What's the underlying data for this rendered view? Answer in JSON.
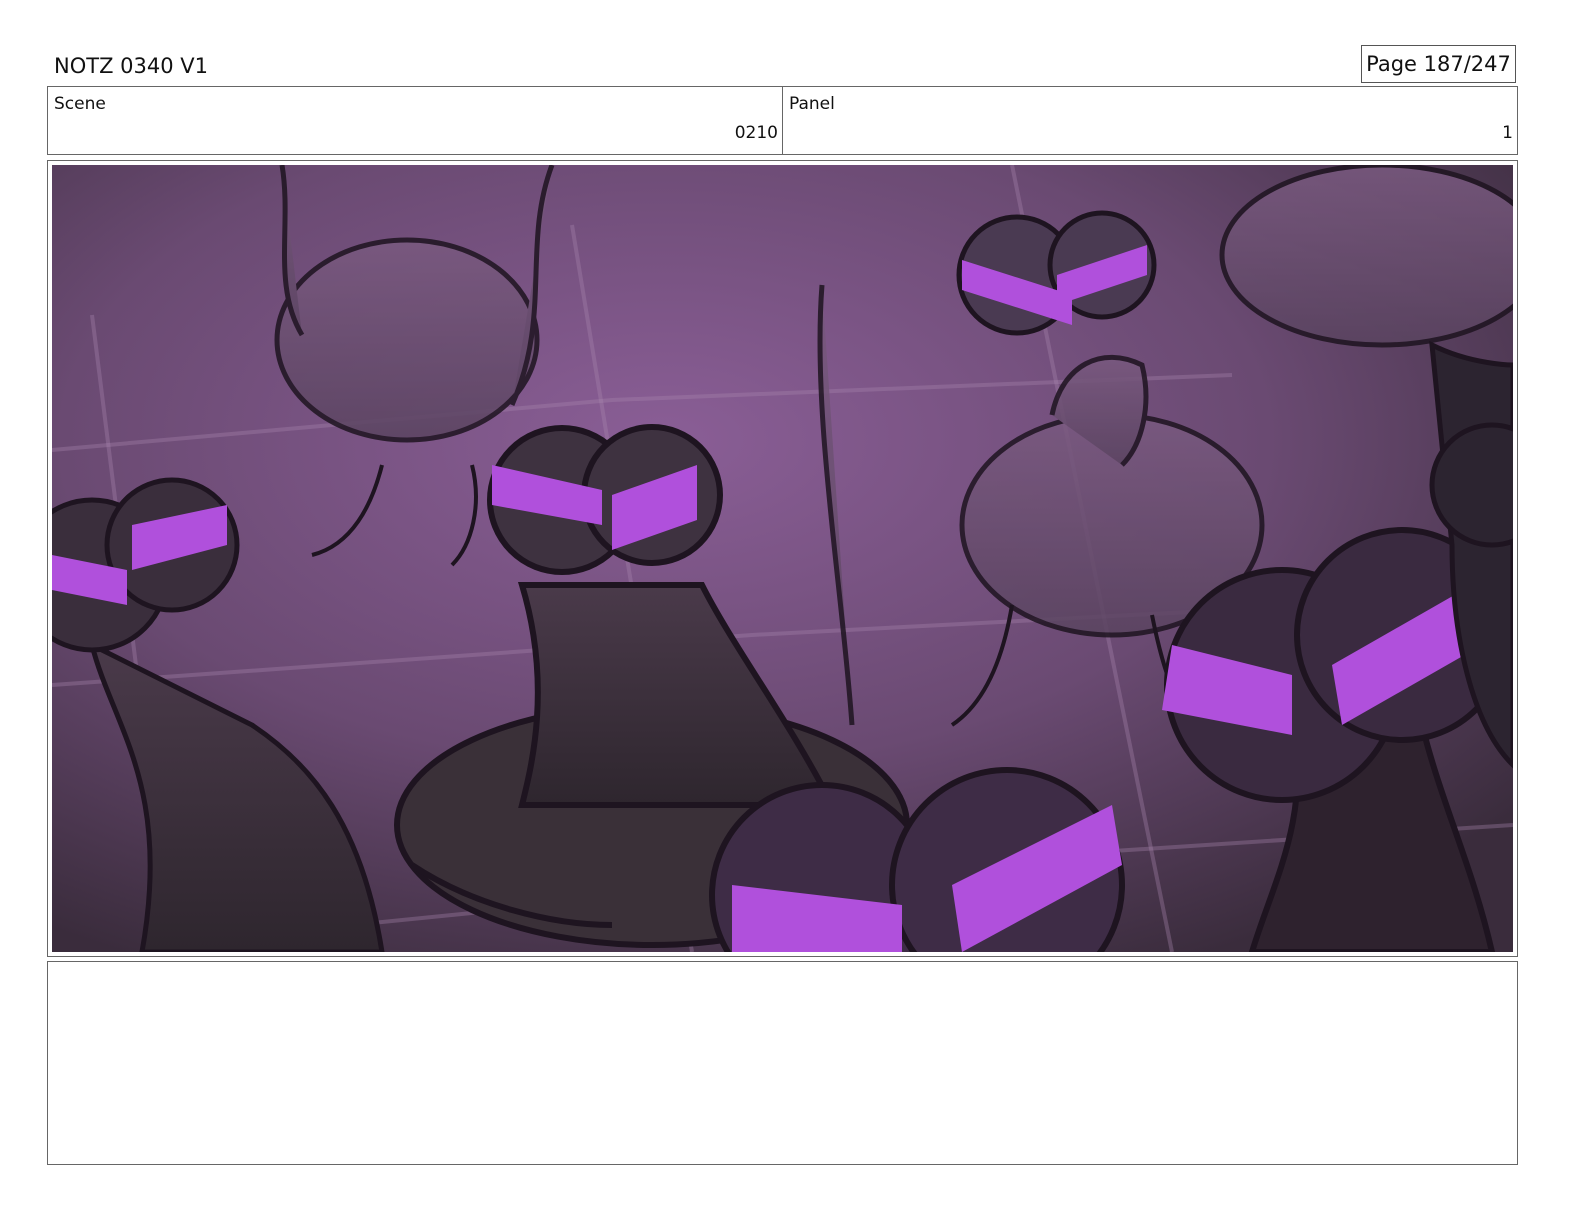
{
  "header": {
    "title": "NOTZ 0340 V1",
    "page": "Page 187/247"
  },
  "info": {
    "scene_label": "Scene",
    "scene_value": "0210",
    "panel_label": "Panel",
    "panel_value": "1"
  },
  "artwork": {
    "description_icon": "storyboard-frog-crowd-image",
    "palette": {
      "background": "#6a4a72",
      "figure_dark": "#3a3038",
      "eye_glow": "#b050dc",
      "line": "#1e1420"
    }
  },
  "notes": {
    "text": ""
  }
}
